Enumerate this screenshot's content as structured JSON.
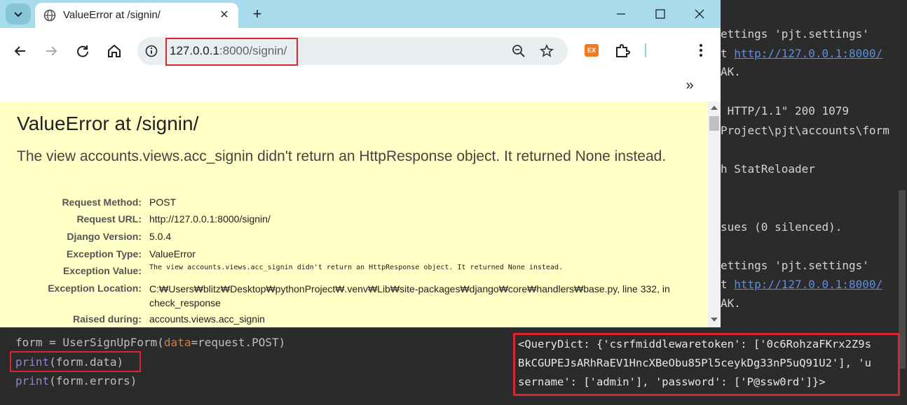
{
  "terminal": {
    "lines": [
      {
        "text": "ettings 'pjt.settings'"
      },
      {
        "prefix": "t ",
        "link": "http://127.0.0.1:8000/"
      },
      {
        "text": "AK."
      },
      {
        "text": " HTTP/1.1\" 200 1079"
      },
      {
        "text": "Project\\pjt\\accounts\\form"
      },
      {
        "text": "h StatReloader"
      },
      {
        "text": "sues (0 silenced)."
      },
      {
        "text": "ettings 'pjt.settings'"
      },
      {
        "prefix": "t ",
        "link": "http://127.0.0.1:8000/"
      },
      {
        "text": "AK."
      }
    ]
  },
  "browser": {
    "tab_title": "ValueError at /signin/",
    "url_host": "127.0.0.1",
    "url_rest": ":8000/signin/",
    "extension_badge": "EX"
  },
  "page": {
    "title": "ValueError at /signin/",
    "description": "The view accounts.views.acc_signin didn't return an HttpResponse object. It returned None instead.",
    "meta": [
      {
        "label": "Request Method:",
        "value": "POST"
      },
      {
        "label": "Request URL:",
        "value": "http://127.0.0.1:8000/signin/"
      },
      {
        "label": "Django Version:",
        "value": "5.0.4"
      },
      {
        "label": "Exception Type:",
        "value": "ValueError"
      },
      {
        "label": "Exception Value:",
        "value": "The view accounts.views.acc_signin didn't return an HttpResponse object. It returned None instead."
      },
      {
        "label": "Exception Location:",
        "value": "C:₩Users₩blitz₩Desktop₩pythonProject₩.venv₩Lib₩site-packages₩django₩core₩handlers₩base.py, line 332, in check_response"
      },
      {
        "label": "Raised during:",
        "value": "accounts.views.acc_signin"
      }
    ]
  },
  "editor": {
    "line1": {
      "a": "form = UserSignUpForm(",
      "kw": "data",
      "b": "=request.POST)"
    },
    "line2": {
      "fn": "print",
      "b": "(form.data)"
    },
    "line3": {
      "fn": "print",
      "b": "(form.errors)"
    }
  },
  "output": {
    "lines": [
      "<QueryDict: {'csrfmiddlewaretoken': ['0c6RohzaFKrx2Z9s",
      "BkCGUPEJsARhRaEV1HncXBeObu85Pl5ceykDg33nP5uQ91U2'], 'u",
      "sername': ['admin'], 'password': ['P@ssw0rd']}>"
    ]
  },
  "colors": {
    "highlight": "#d9262f",
    "page_bg": "#ffffc6",
    "tab_bar": "#a8dcec"
  }
}
